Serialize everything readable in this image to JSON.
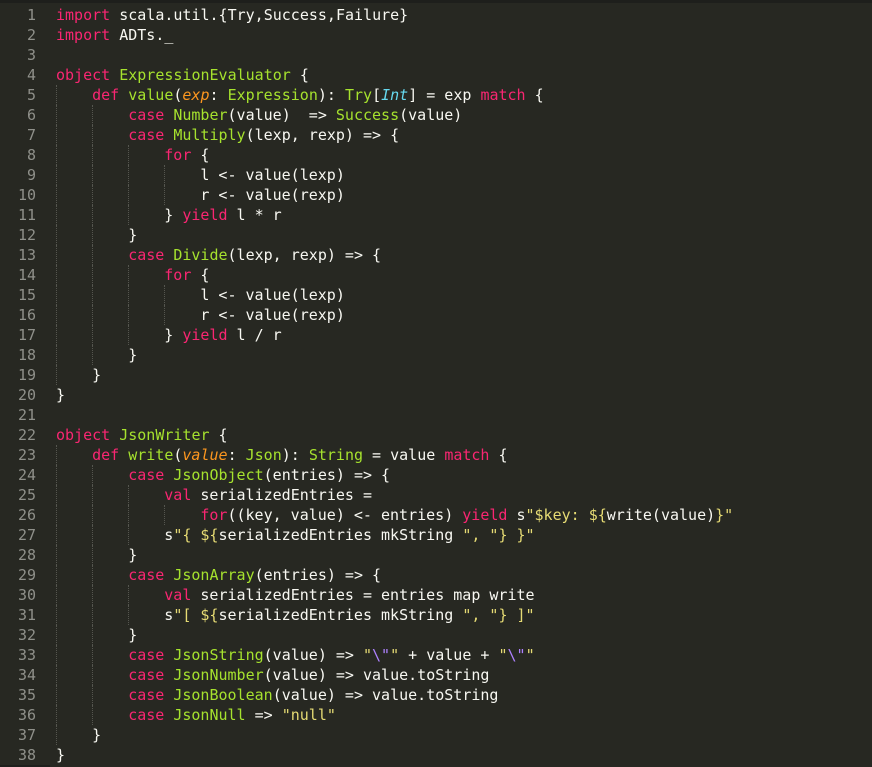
{
  "editor": {
    "theme_colors": {
      "background": "#272822",
      "keyword": "#f92672",
      "type": "#a6e22e",
      "parameter": "#fd971f",
      "builtin_type": "#66d9ef",
      "string": "#e6db74",
      "escape": "#ae81ff",
      "text": "#f8f8f2",
      "line_number": "#8f908a"
    },
    "lines": [
      {
        "n": "1",
        "indent": 0,
        "tokens": [
          [
            "k",
            "import"
          ],
          [
            "n",
            " scala.util.{Try,Success,Failure}"
          ]
        ]
      },
      {
        "n": "2",
        "indent": 0,
        "tokens": [
          [
            "k",
            "import"
          ],
          [
            "n",
            " ADTs._"
          ]
        ]
      },
      {
        "n": "3",
        "indent": 0,
        "tokens": []
      },
      {
        "n": "4",
        "indent": 0,
        "tokens": [
          [
            "k",
            "object"
          ],
          [
            "n",
            " "
          ],
          [
            "t",
            "ExpressionEvaluator"
          ],
          [
            "n",
            " {"
          ]
        ]
      },
      {
        "n": "5",
        "indent": 1,
        "tokens": [
          [
            "k",
            "def"
          ],
          [
            "n",
            " "
          ],
          [
            "t",
            "value"
          ],
          [
            "n",
            "("
          ],
          [
            "p",
            "exp"
          ],
          [
            "n",
            ": "
          ],
          [
            "t",
            "Expression"
          ],
          [
            "n",
            "): "
          ],
          [
            "t",
            "Try"
          ],
          [
            "n",
            "["
          ],
          [
            "i",
            "Int"
          ],
          [
            "n",
            "] = exp "
          ],
          [
            "k",
            "match"
          ],
          [
            "n",
            " {"
          ]
        ]
      },
      {
        "n": "6",
        "indent": 2,
        "tokens": [
          [
            "k",
            "case"
          ],
          [
            "n",
            " "
          ],
          [
            "t",
            "Number"
          ],
          [
            "n",
            "(value)  => "
          ],
          [
            "t",
            "Success"
          ],
          [
            "n",
            "(value)"
          ]
        ]
      },
      {
        "n": "7",
        "indent": 2,
        "tokens": [
          [
            "k",
            "case"
          ],
          [
            "n",
            " "
          ],
          [
            "t",
            "Multiply"
          ],
          [
            "n",
            "(lexp, rexp) => {"
          ]
        ]
      },
      {
        "n": "8",
        "indent": 3,
        "tokens": [
          [
            "k",
            "for"
          ],
          [
            "n",
            " {"
          ]
        ]
      },
      {
        "n": "9",
        "indent": 4,
        "tokens": [
          [
            "n",
            "l <- value(lexp)"
          ]
        ]
      },
      {
        "n": "10",
        "indent": 4,
        "tokens": [
          [
            "n",
            "r <- value(rexp)"
          ]
        ]
      },
      {
        "n": "11",
        "indent": 3,
        "tokens": [
          [
            "n",
            "} "
          ],
          [
            "k",
            "yield"
          ],
          [
            "n",
            " l * r"
          ]
        ]
      },
      {
        "n": "12",
        "indent": 2,
        "tokens": [
          [
            "n",
            "}"
          ]
        ]
      },
      {
        "n": "13",
        "indent": 2,
        "tokens": [
          [
            "k",
            "case"
          ],
          [
            "n",
            " "
          ],
          [
            "t",
            "Divide"
          ],
          [
            "n",
            "(lexp, rexp) => {"
          ]
        ]
      },
      {
        "n": "14",
        "indent": 3,
        "tokens": [
          [
            "k",
            "for"
          ],
          [
            "n",
            " {"
          ]
        ]
      },
      {
        "n": "15",
        "indent": 4,
        "tokens": [
          [
            "n",
            "l <- value(lexp)"
          ]
        ]
      },
      {
        "n": "16",
        "indent": 4,
        "tokens": [
          [
            "n",
            "r <- value(rexp)"
          ]
        ]
      },
      {
        "n": "17",
        "indent": 3,
        "tokens": [
          [
            "n",
            "} "
          ],
          [
            "k",
            "yield"
          ],
          [
            "n",
            " l / r"
          ]
        ]
      },
      {
        "n": "18",
        "indent": 2,
        "tokens": [
          [
            "n",
            "}"
          ]
        ]
      },
      {
        "n": "19",
        "indent": 1,
        "tokens": [
          [
            "n",
            "}"
          ]
        ]
      },
      {
        "n": "20",
        "indent": 0,
        "tokens": [
          [
            "n",
            "}"
          ]
        ]
      },
      {
        "n": "21",
        "indent": 0,
        "tokens": []
      },
      {
        "n": "22",
        "indent": 0,
        "tokens": [
          [
            "k",
            "object"
          ],
          [
            "n",
            " "
          ],
          [
            "t",
            "JsonWriter"
          ],
          [
            "n",
            " {"
          ]
        ]
      },
      {
        "n": "23",
        "indent": 1,
        "tokens": [
          [
            "k",
            "def"
          ],
          [
            "n",
            " "
          ],
          [
            "t",
            "write"
          ],
          [
            "n",
            "("
          ],
          [
            "p",
            "value"
          ],
          [
            "n",
            ": "
          ],
          [
            "t",
            "Json"
          ],
          [
            "n",
            "): "
          ],
          [
            "t",
            "String"
          ],
          [
            "n",
            " = value "
          ],
          [
            "k",
            "match"
          ],
          [
            "n",
            " {"
          ]
        ]
      },
      {
        "n": "24",
        "indent": 2,
        "tokens": [
          [
            "k",
            "case"
          ],
          [
            "n",
            " "
          ],
          [
            "t",
            "JsonObject"
          ],
          [
            "n",
            "(entries) => {"
          ]
        ]
      },
      {
        "n": "25",
        "indent": 3,
        "tokens": [
          [
            "k",
            "val"
          ],
          [
            "n",
            " serializedEntries ="
          ]
        ]
      },
      {
        "n": "26",
        "indent": 4,
        "tokens": [
          [
            "k",
            "for"
          ],
          [
            "n",
            "((key, value) <- entries) "
          ],
          [
            "k",
            "yield"
          ],
          [
            "n",
            " s"
          ],
          [
            "s",
            "\"$key: ${"
          ],
          [
            "n",
            "write(value)"
          ],
          [
            "s",
            "}\""
          ]
        ]
      },
      {
        "n": "27",
        "indent": 3,
        "tokens": [
          [
            "n",
            "s"
          ],
          [
            "s",
            "\"{ ${"
          ],
          [
            "n",
            "serializedEntries mkString "
          ],
          [
            "s",
            "\", \""
          ],
          [
            "s",
            "} }\""
          ]
        ]
      },
      {
        "n": "28",
        "indent": 2,
        "tokens": [
          [
            "n",
            "}"
          ]
        ]
      },
      {
        "n": "29",
        "indent": 2,
        "tokens": [
          [
            "k",
            "case"
          ],
          [
            "n",
            " "
          ],
          [
            "t",
            "JsonArray"
          ],
          [
            "n",
            "(entries) => {"
          ]
        ]
      },
      {
        "n": "30",
        "indent": 3,
        "tokens": [
          [
            "k",
            "val"
          ],
          [
            "n",
            " serializedEntries = entries map write"
          ]
        ]
      },
      {
        "n": "31",
        "indent": 3,
        "tokens": [
          [
            "n",
            "s"
          ],
          [
            "s",
            "\"[ ${"
          ],
          [
            "n",
            "serializedEntries mkString "
          ],
          [
            "s",
            "\", \""
          ],
          [
            "s",
            "} ]\""
          ]
        ]
      },
      {
        "n": "32",
        "indent": 2,
        "tokens": [
          [
            "n",
            "}"
          ]
        ]
      },
      {
        "n": "33",
        "indent": 2,
        "tokens": [
          [
            "k",
            "case"
          ],
          [
            "n",
            " "
          ],
          [
            "t",
            "JsonString"
          ],
          [
            "n",
            "(value) => "
          ],
          [
            "s",
            "\""
          ],
          [
            "e",
            "\\\""
          ],
          [
            "s",
            "\""
          ],
          [
            "n",
            " + value + "
          ],
          [
            "s",
            "\""
          ],
          [
            "e",
            "\\\""
          ],
          [
            "s",
            "\""
          ]
        ]
      },
      {
        "n": "34",
        "indent": 2,
        "tokens": [
          [
            "k",
            "case"
          ],
          [
            "n",
            " "
          ],
          [
            "t",
            "JsonNumber"
          ],
          [
            "n",
            "(value) => value.toString"
          ]
        ]
      },
      {
        "n": "35",
        "indent": 2,
        "tokens": [
          [
            "k",
            "case"
          ],
          [
            "n",
            " "
          ],
          [
            "t",
            "JsonBoolean"
          ],
          [
            "n",
            "(value) => value.toString"
          ]
        ]
      },
      {
        "n": "36",
        "indent": 2,
        "tokens": [
          [
            "k",
            "case"
          ],
          [
            "n",
            " "
          ],
          [
            "t",
            "JsonNull"
          ],
          [
            "n",
            " => "
          ],
          [
            "s",
            "\"null\""
          ]
        ]
      },
      {
        "n": "37",
        "indent": 1,
        "tokens": [
          [
            "n",
            "}"
          ]
        ]
      },
      {
        "n": "38",
        "indent": 0,
        "tokens": [
          [
            "n",
            "}"
          ]
        ]
      }
    ]
  }
}
